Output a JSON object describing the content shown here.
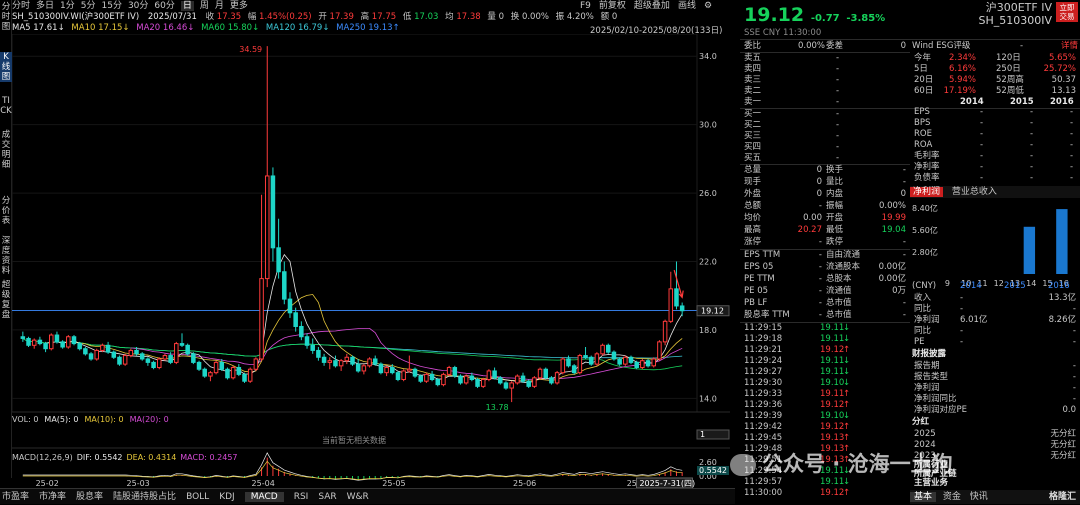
{
  "left_tabs": [
    "分时图",
    "K线图",
    "TICK",
    "成交明细",
    "分价表",
    "深度资料",
    "超级复盘"
  ],
  "topbar": {
    "items": [
      "分时",
      "多日",
      "1分",
      "5分",
      "15分",
      "30分",
      "60分",
      "日",
      "周",
      "月",
      "更多"
    ],
    "active": "日",
    "right": [
      "F9",
      "前复权",
      "超级叠加",
      "画线",
      "⚙"
    ]
  },
  "info": {
    "symbol": "SH_510300IV.WI(沪300ETF IV)",
    "date": "2025/07/31",
    "open_label": "收",
    "close": "17.35",
    "chg_label": "幅",
    "chg": "1.45%(0.25)",
    "o_label": "开",
    "o": "17.39",
    "h_label": "高",
    "h": "17.75",
    "l_label": "低",
    "l": "17.03",
    "avg_label": "均",
    "avg": "17.38",
    "vol_label": "量",
    "vol": "0",
    "turn_label": "换",
    "turn": "0.00%",
    "amp_label": "振",
    "amp": "4.20%",
    "amount_label": "额",
    "amount": "0"
  },
  "ma": {
    "ma5": "MA5 17.61↓",
    "ma10": "MA10 17.15↓",
    "ma20": "MA20 16.46↓",
    "ma60": "MA60 15.80↓",
    "ma120": "MA120 16.79↓",
    "ma250": "MA250 19.13↑"
  },
  "date_range": "2025/02/10-2025/08/20(133日)",
  "chart_data": {
    "type": "candlestick",
    "y_ticks": [
      "34.0",
      "30.0",
      "26.0",
      "22.0",
      "18.0",
      "14.0"
    ],
    "x_labels": [
      "25-02",
      "25-03",
      "25-04",
      "25-05",
      "25-06",
      "25-07"
    ],
    "last_price": "19.12",
    "max_label": "34.59",
    "min_label": "13.78",
    "ma250": 19.13,
    "candles": [
      [
        17.6,
        17.9,
        17.3,
        17.5
      ],
      [
        17.5,
        17.6,
        17.0,
        17.1
      ],
      [
        17.1,
        17.5,
        16.9,
        17.4
      ],
      [
        17.4,
        17.6,
        17.1,
        17.2
      ],
      [
        17.2,
        17.3,
        16.7,
        16.9
      ],
      [
        16.9,
        17.8,
        16.8,
        17.7
      ],
      [
        17.7,
        17.9,
        17.2,
        17.3
      ],
      [
        17.3,
        17.4,
        16.9,
        17.0
      ],
      [
        17.0,
        17.7,
        16.9,
        17.6
      ],
      [
        17.6,
        17.7,
        17.1,
        17.2
      ],
      [
        17.2,
        17.3,
        16.8,
        16.9
      ],
      [
        16.9,
        17.0,
        16.5,
        16.6
      ],
      [
        16.6,
        16.7,
        16.2,
        16.3
      ],
      [
        16.3,
        16.9,
        16.2,
        16.8
      ],
      [
        16.8,
        17.2,
        16.7,
        17.1
      ],
      [
        17.1,
        17.3,
        16.6,
        16.7
      ],
      [
        16.7,
        16.8,
        16.3,
        16.4
      ],
      [
        16.4,
        16.5,
        15.9,
        16.0
      ],
      [
        16.0,
        16.6,
        15.9,
        16.5
      ],
      [
        16.5,
        16.9,
        16.4,
        16.8
      ],
      [
        16.8,
        17.0,
        16.5,
        16.6
      ],
      [
        16.6,
        16.7,
        16.2,
        16.3
      ],
      [
        16.3,
        16.4,
        15.9,
        16.1
      ],
      [
        16.1,
        16.2,
        15.7,
        15.8
      ],
      [
        15.8,
        16.4,
        15.7,
        16.3
      ],
      [
        16.3,
        16.6,
        16.2,
        16.5
      ],
      [
        16.5,
        16.7,
        16.0,
        16.1
      ],
      [
        16.1,
        17.3,
        16.0,
        17.2
      ],
      [
        17.2,
        17.8,
        17.0,
        17.1
      ],
      [
        17.1,
        17.2,
        16.5,
        16.6
      ],
      [
        16.6,
        16.7,
        16.0,
        16.1
      ],
      [
        16.1,
        16.2,
        15.6,
        15.7
      ],
      [
        15.7,
        15.8,
        15.2,
        15.3
      ],
      [
        15.3,
        15.6,
        15.0,
        15.5
      ],
      [
        15.5,
        16.2,
        15.4,
        16.1
      ],
      [
        16.1,
        16.3,
        15.6,
        15.7
      ],
      [
        15.7,
        15.8,
        15.1,
        15.2
      ],
      [
        15.2,
        15.9,
        15.1,
        15.8
      ],
      [
        15.8,
        16.0,
        15.3,
        15.4
      ],
      [
        15.4,
        15.5,
        14.9,
        15.0
      ],
      [
        15.0,
        15.8,
        14.9,
        15.7
      ],
      [
        15.7,
        16.4,
        15.6,
        16.3
      ],
      [
        16.3,
        25.9,
        16.2,
        21.0
      ],
      [
        21.0,
        34.59,
        20.5,
        27.0
      ],
      [
        27.0,
        27.5,
        22.0,
        22.8
      ],
      [
        22.8,
        24.5,
        21.0,
        21.4
      ],
      [
        21.4,
        22.0,
        19.5,
        19.8
      ],
      [
        19.8,
        20.2,
        18.7,
        19.0
      ],
      [
        19.0,
        19.3,
        17.9,
        18.2
      ],
      [
        18.2,
        18.5,
        17.4,
        17.6
      ],
      [
        17.6,
        17.8,
        16.9,
        17.1
      ],
      [
        17.1,
        17.5,
        16.6,
        16.8
      ],
      [
        16.8,
        17.0,
        16.2,
        16.4
      ],
      [
        16.4,
        16.6,
        15.9,
        16.1
      ],
      [
        16.1,
        16.4,
        15.7,
        16.2
      ],
      [
        16.2,
        16.5,
        15.8,
        15.9
      ],
      [
        15.9,
        16.3,
        15.6,
        16.2
      ],
      [
        16.2,
        16.6,
        16.0,
        16.4
      ],
      [
        16.4,
        16.5,
        15.9,
        16.0
      ],
      [
        16.0,
        16.3,
        15.5,
        15.6
      ],
      [
        15.6,
        16.0,
        15.4,
        15.9
      ],
      [
        15.9,
        16.4,
        15.8,
        16.3
      ],
      [
        16.3,
        16.5,
        15.9,
        16.0
      ],
      [
        16.0,
        16.1,
        15.4,
        15.5
      ],
      [
        15.5,
        15.9,
        15.3,
        15.8
      ],
      [
        15.8,
        16.0,
        15.4,
        15.5
      ],
      [
        15.5,
        15.6,
        15.0,
        15.1
      ],
      [
        15.1,
        15.7,
        15.0,
        15.6
      ],
      [
        15.6,
        16.5,
        15.5,
        15.7
      ],
      [
        15.7,
        15.8,
        15.2,
        15.3
      ],
      [
        15.3,
        15.4,
        14.9,
        15.0
      ],
      [
        15.0,
        15.5,
        14.9,
        15.4
      ],
      [
        15.4,
        15.6,
        15.0,
        15.1
      ],
      [
        15.1,
        15.2,
        14.7,
        14.8
      ],
      [
        14.8,
        15.5,
        14.7,
        15.4
      ],
      [
        15.4,
        15.9,
        15.3,
        15.8
      ],
      [
        15.8,
        15.9,
        15.2,
        15.3
      ],
      [
        15.3,
        15.4,
        14.8,
        14.9
      ],
      [
        14.9,
        15.4,
        14.8,
        15.3
      ],
      [
        15.3,
        15.5,
        15.0,
        15.1
      ],
      [
        15.1,
        15.2,
        14.6,
        14.7
      ],
      [
        14.7,
        15.2,
        14.6,
        15.1
      ],
      [
        15.1,
        15.7,
        15.0,
        15.6
      ],
      [
        15.6,
        15.8,
        15.1,
        15.2
      ],
      [
        15.2,
        15.3,
        14.8,
        14.9
      ],
      [
        14.9,
        15.0,
        14.5,
        14.6
      ],
      [
        14.6,
        15.0,
        13.78,
        14.9
      ],
      [
        14.9,
        15.4,
        14.8,
        15.3
      ],
      [
        15.3,
        15.5,
        14.9,
        15.0
      ],
      [
        15.0,
        15.1,
        14.6,
        14.7
      ],
      [
        14.7,
        15.3,
        14.6,
        15.2
      ],
      [
        15.2,
        15.8,
        15.1,
        15.7
      ],
      [
        15.7,
        15.8,
        15.1,
        15.2
      ],
      [
        15.2,
        15.3,
        14.8,
        14.9
      ],
      [
        14.9,
        15.6,
        14.8,
        15.5
      ],
      [
        15.5,
        16.4,
        15.4,
        16.3
      ],
      [
        16.3,
        16.5,
        15.8,
        15.9
      ],
      [
        15.9,
        16.0,
        15.4,
        15.5
      ],
      [
        15.5,
        16.6,
        15.4,
        16.5
      ],
      [
        16.5,
        17.0,
        16.3,
        16.4
      ],
      [
        16.4,
        16.5,
        15.9,
        16.0
      ],
      [
        16.0,
        16.7,
        15.9,
        16.6
      ],
      [
        16.6,
        17.2,
        16.5,
        17.1
      ],
      [
        17.1,
        17.2,
        16.6,
        16.7
      ],
      [
        16.7,
        16.8,
        16.2,
        16.3
      ],
      [
        16.3,
        16.4,
        15.9,
        16.0
      ],
      [
        16.0,
        16.5,
        15.9,
        16.4
      ],
      [
        16.4,
        16.5,
        16.0,
        16.1
      ],
      [
        16.1,
        16.2,
        15.7,
        15.8
      ],
      [
        15.8,
        16.3,
        15.7,
        16.2
      ],
      [
        16.2,
        16.3,
        15.8,
        15.9
      ],
      [
        15.9,
        16.4,
        15.8,
        16.3
      ],
      [
        16.3,
        17.4,
        16.2,
        17.3
      ],
      [
        17.3,
        18.6,
        17.1,
        18.5
      ],
      [
        18.5,
        21.4,
        18.4,
        20.4
      ],
      [
        20.4,
        22.0,
        19.2,
        19.4
      ],
      [
        19.4,
        19.6,
        18.8,
        19.12
      ]
    ],
    "macd": {
      "label": "MACD(12,26,9)",
      "dif": "DIF: 0.5542",
      "dea": "DEA: 0.4314",
      "macd": "MACD: 0.2457",
      "ticks": [
        "2.60",
        "0.00"
      ],
      "last": "0.5542"
    },
    "vol": {
      "label": "VOL: 0",
      "ma5": "MA(5): 0",
      "ma10": "MA(10): 0",
      "ma20": "MA(20): 0",
      "empty": "当前暂无相关数据",
      "value": "1"
    },
    "cursor_date": "2025-7-31(四)"
  },
  "bottom_tabs": [
    "市盈率",
    "市净率",
    "股息率",
    "陆股通持股占比",
    "BOLL",
    "KDJ",
    "MACD",
    "RSI",
    "SAR",
    "W&R"
  ],
  "bottom_active": "MACD",
  "quote": {
    "price": "19.12",
    "change": "-0.77",
    "pct": "-3.85%",
    "name": "沪300ETF IV",
    "code": "SH_510300IV",
    "badge1": "立即",
    "badge2": "交易",
    "meta": "SSE  CNY  11:30:00"
  },
  "book": {
    "weibi_label": "委比",
    "weibi": "0.00%",
    "weicha_label": "委差",
    "weicha": "0",
    "asks": [
      "卖五",
      "卖四",
      "卖三",
      "卖二",
      "卖一"
    ],
    "bids": [
      "买一",
      "买二",
      "买三",
      "买四",
      "买五"
    ],
    "dash": "-"
  },
  "stats": [
    [
      "总量",
      "0",
      "换手",
      "-"
    ],
    [
      "现手",
      "0",
      "量比",
      "-"
    ],
    [
      "外盘",
      "0",
      "内盘",
      "0"
    ],
    [
      "总额",
      "-",
      "振幅",
      "0.00%"
    ],
    [
      "均价",
      "0.00",
      "开盘",
      "19.99"
    ],
    [
      "最高",
      "20.27",
      "最低",
      "19.04"
    ],
    [
      "涨停",
      "-",
      "跌停",
      "-"
    ]
  ],
  "fund": [
    [
      "EPS TTM",
      "-",
      "自由流通",
      "-"
    ],
    [
      "EPS 05",
      "-",
      "流通股本",
      "0.00亿"
    ],
    [
      "PE TTM",
      "-",
      "总股本",
      "0.00亿"
    ],
    [
      "PE 05",
      "-",
      "流通值",
      "0万"
    ],
    [
      "PB LF",
      "-",
      "总市值",
      "-"
    ],
    [
      "股息率 TTM",
      "-",
      "总市值",
      "-"
    ]
  ],
  "ticks": [
    [
      "11:29:15",
      "19.11",
      "↓"
    ],
    [
      "11:29:18",
      "19.11",
      "↓"
    ],
    [
      "11:29:21",
      "19.12",
      "↑"
    ],
    [
      "11:29:24",
      "19.11",
      "↓"
    ],
    [
      "11:29:27",
      "19.11",
      "↓"
    ],
    [
      "11:29:30",
      "19.10",
      "↓"
    ],
    [
      "11:29:33",
      "19.11",
      "↑"
    ],
    [
      "11:29:36",
      "19.12",
      "↑"
    ],
    [
      "11:29:39",
      "19.10",
      "↓"
    ],
    [
      "11:29:42",
      "19.12",
      "↑"
    ],
    [
      "11:29:45",
      "19.13",
      "↑"
    ],
    [
      "11:29:48",
      "19.13",
      "↑"
    ],
    [
      "11:29:51",
      "19.13",
      "↑"
    ],
    [
      "11:29:54",
      "19.11",
      "↓"
    ],
    [
      "11:29:57",
      "19.11",
      "↓"
    ],
    [
      "11:30:00",
      "19.12",
      "↑"
    ]
  ],
  "esg": {
    "label": "Wind ESG评级",
    "dash": "-",
    "detail": "详情"
  },
  "perf": [
    [
      "今年",
      "2.34%",
      "120日",
      "5.65%"
    ],
    [
      "5日",
      "6.16%",
      "250日",
      "25.72%"
    ],
    [
      "20日",
      "5.94%",
      "52周高",
      "50.37"
    ],
    [
      "60日",
      "17.19%",
      "52周低",
      "13.13"
    ]
  ],
  "years": [
    "2014",
    "2015",
    "2016"
  ],
  "ratios": [
    "EPS",
    "BPS",
    "ROE",
    "ROA",
    "毛利率",
    "净利率",
    "负债率"
  ],
  "netprofit_tab": "净利润",
  "revenue_tab": "营业总收入",
  "bar_chart": {
    "yticks": [
      "8.40亿",
      "5.60亿",
      "2.80亿"
    ],
    "x": [
      "9",
      "10",
      "11",
      "12",
      "13",
      "14",
      "15",
      "16"
    ],
    "years": [
      "2014",
      "2015",
      "2016"
    ],
    "values": [
      0,
      0,
      0,
      0,
      0,
      6.01,
      0,
      8.26
    ],
    "max": 8.4
  },
  "cny_label": "(CNY)",
  "fin_rows": [
    [
      "收入",
      "-",
      "13.3亿"
    ],
    [
      "同比",
      "-",
      "-"
    ],
    [
      "净利润",
      "6.01亿",
      "8.26亿"
    ],
    [
      "同比",
      "-",
      "-"
    ],
    [
      "PE",
      "-",
      "-"
    ]
  ],
  "report_title": "财报披露",
  "report_rows": [
    [
      "报告期",
      "-"
    ],
    [
      "报告类型",
      "-"
    ],
    [
      "净利润",
      "-"
    ],
    [
      "净利润同比",
      "-"
    ],
    [
      "净利润对应PE",
      "0.0"
    ]
  ],
  "dividend_title": "分红",
  "dividend_rows": [
    [
      "2025",
      "无分红"
    ],
    [
      "2024",
      "无分红"
    ],
    [
      "2023",
      "无分红"
    ]
  ],
  "bottom_right_tabs": [
    "基本",
    "资金",
    "快讯"
  ],
  "extra_labels": [
    "所属行业",
    "所属产业链",
    "主营业务"
  ],
  "watermark": "公众号 · 沧海一土狗",
  "logo": "格隆汇"
}
